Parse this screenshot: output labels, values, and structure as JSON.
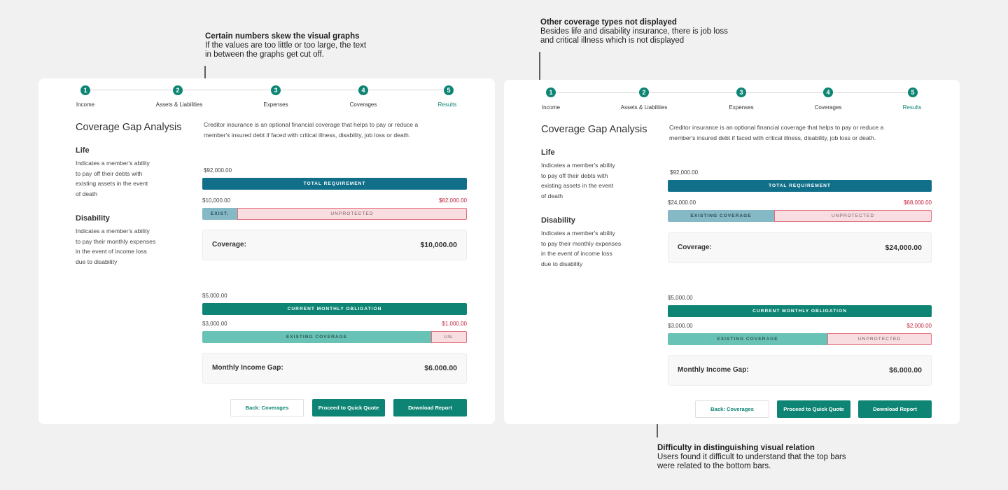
{
  "annotations": {
    "skew": {
      "title": "Certain numbers skew the visual graphs",
      "lines": [
        "If the values are too little or too large, the text",
        "in between the graphs get cut off."
      ]
    },
    "other": {
      "title": "Other coverage types not displayed",
      "lines": [
        "Besides life and disability insurance, there is job loss",
        "and critical illness which is not displayed"
      ]
    },
    "relation": {
      "title": "Difficulty in distinguishing visual relation",
      "lines": [
        "Users found it difficult to understand that the top bars",
        "were related to the bottom bars."
      ]
    }
  },
  "steps": [
    {
      "num": "1",
      "label": "Income"
    },
    {
      "num": "2",
      "label": "Assets & Liabilities"
    },
    {
      "num": "3",
      "label": "Expenses"
    },
    {
      "num": "4",
      "label": "Coverages"
    },
    {
      "num": "5",
      "label": "Results"
    }
  ],
  "common": {
    "page_title": "Coverage Gap Analysis",
    "intro_lines": [
      "Creditor insurance is an optional financial coverage that helps to pay or reduce a",
      "member's insured debt if faced with critical illness, disability, job loss or death."
    ],
    "life_title": "Life",
    "life_desc": [
      "Indicates a member's ability",
      "to pay off their debts with",
      "existing assets in the event",
      "of death"
    ],
    "dis_title": "Disability",
    "dis_desc": [
      "Indicates a member's ability",
      "to pay their monthly expenses",
      "in the event of income loss",
      "due to disability"
    ],
    "total_label": "TOTAL REQUIREMENT",
    "oblig_label": "CURRENT MONTHLY OBLIGATION",
    "coverage_label": "Coverage:",
    "gap_label": "Monthly Income Gap:",
    "btn_back": "Back: Coverages",
    "btn_quote": "Proceed to Quick Quote",
    "btn_download": "Download Report"
  },
  "cards": [
    {
      "life": {
        "total": "$92,000.00",
        "existing": "$10,000.00",
        "unprotected": "$82,000.00",
        "exist_label": "EXIST.",
        "unprot_label": "UNPROTECTED",
        "coverage": "$10,000.00"
      },
      "dis": {
        "obligation": "$5,000.00",
        "existing": "$3,000.00",
        "unprotected": "$1,000.00",
        "exist_label": "EXISTING COVERAGE",
        "unprot_label": "UN.",
        "gap": "$6.000.00"
      }
    },
    {
      "life": {
        "total": "$92,000.00",
        "existing": "$24,000.00",
        "unprotected": "$68,000.00",
        "exist_label": "EXISTING COVERAGE",
        "unprot_label": "UNPROTECTED",
        "coverage": "$24,000.00"
      },
      "dis": {
        "obligation": "$5,000.00",
        "existing": "$3,000.00",
        "unprotected": "$2,000.00",
        "exist_label": "EXISTING COVERAGE",
        "unprot_label": "UNPROTECTED",
        "gap": "$6.000.00"
      }
    }
  ]
}
